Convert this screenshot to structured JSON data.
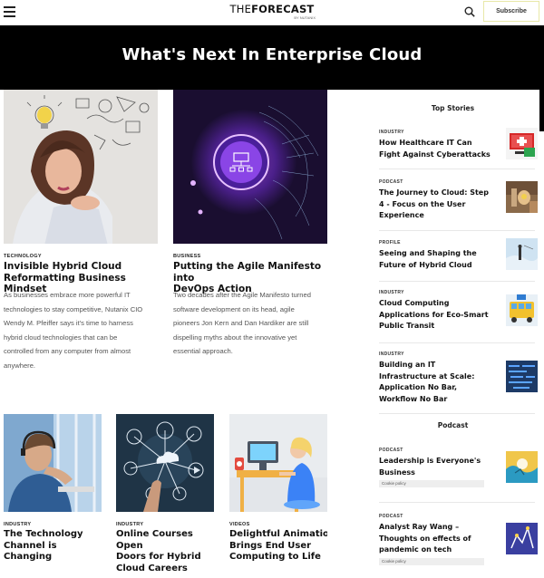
{
  "header": {
    "logo_text_light": "THE",
    "logo_text_bold": "FORECAST",
    "logo_sub": "BY NUTANIX",
    "subscribe_label": "Subscribe"
  },
  "hero": {
    "title": "What's Next In Enterprise Cloud"
  },
  "featured": [
    {
      "category": "TECHNOLOGY",
      "title_lines": [
        "Invisible Hybrid Cloud",
        "Reformatting Business Mindset"
      ],
      "desc_lines": [
        "As businesses embrace more powerful IT",
        "technologies to stay competitive, Nutanix CIO",
        "Wendy M. Pfeiffer says it's time to harness",
        "hybrid cloud technologies that can be",
        "controlled from any computer from almost",
        "anywhere."
      ]
    },
    {
      "category": "BUSINESS",
      "title_lines": [
        "Putting the Agile Manifesto into",
        "DevOps Action"
      ],
      "desc_lines": [
        "Two decades after the Agile Manifesto turned",
        "software development on its head, agile",
        "pioneers Jon Kern and Dan Hardiker are still",
        "dispelling myths about the innovative yet",
        "essential approach."
      ]
    }
  ],
  "small_cards": [
    {
      "category": "INDUSTRY",
      "title_lines": [
        "The Technology",
        "Channel is Changing"
      ]
    },
    {
      "category": "INDUSTRY",
      "title_lines": [
        "Online Courses Open",
        "Doors for Hybrid",
        "Cloud Careers"
      ]
    },
    {
      "category": "VIDEOS",
      "title_lines": [
        "Delightful Animation",
        "Brings End User",
        "Computing to Life"
      ]
    }
  ],
  "sidebar": {
    "top_stories_heading": "Top Stories",
    "podcast_heading": "Podcast",
    "top_stories": [
      {
        "category": "INDUSTRY",
        "title_lines": [
          "How Healthcare IT Can",
          "Fight Against Cyberattacks"
        ]
      },
      {
        "category": "PODCAST",
        "title_lines": [
          "The Journey to Cloud: Step",
          "4 - Focus on the User",
          "Experience"
        ]
      },
      {
        "category": "PROFILE",
        "title_lines": [
          "Seeing and Shaping the",
          "Future of Hybrid Cloud"
        ]
      },
      {
        "category": "INDUSTRY",
        "title_lines": [
          "Cloud Computing",
          "Applications for Eco-Smart",
          "Public Transit"
        ]
      },
      {
        "category": "INDUSTRY",
        "title_lines": [
          "Building an IT",
          "Infrastructure at Scale:",
          "Application No Bar,",
          "Workflow No Bar"
        ]
      }
    ],
    "podcasts": [
      {
        "category": "PODCAST",
        "title_lines": [
          "Leadership is Everyone's",
          "Business"
        ],
        "cookie": "Cookie policy"
      },
      {
        "category": "PODCAST",
        "title_lines": [
          "Analyst Ray Wang –",
          "Thoughts on effects of",
          "pandemic on tech"
        ],
        "cookie": "Cookie policy"
      }
    ]
  },
  "colors": {
    "hero_bg": "#000000",
    "subscribe_border": "#e8e8a8"
  }
}
